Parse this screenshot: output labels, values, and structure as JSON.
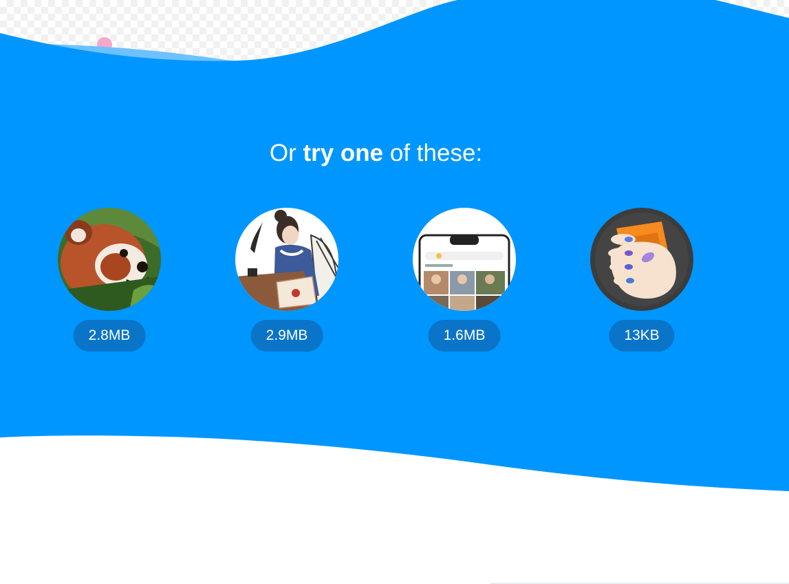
{
  "heading": {
    "prefix": "Or ",
    "bold": "try one",
    "suffix": " of these:"
  },
  "demos": [
    {
      "size": "2.8MB",
      "icon": "red-panda-photo"
    },
    {
      "size": "2.9MB",
      "icon": "woman-writing-illustration"
    },
    {
      "size": "1.6MB",
      "icon": "phone-photos-screenshot"
    },
    {
      "size": "13KB",
      "icon": "hand-holding-logo"
    }
  ],
  "colors": {
    "blue_band": "#0096ff",
    "size_pill": "#0a74c8",
    "light_wave": "#6ec1ff",
    "pink_dot": "#f7a8c9"
  }
}
